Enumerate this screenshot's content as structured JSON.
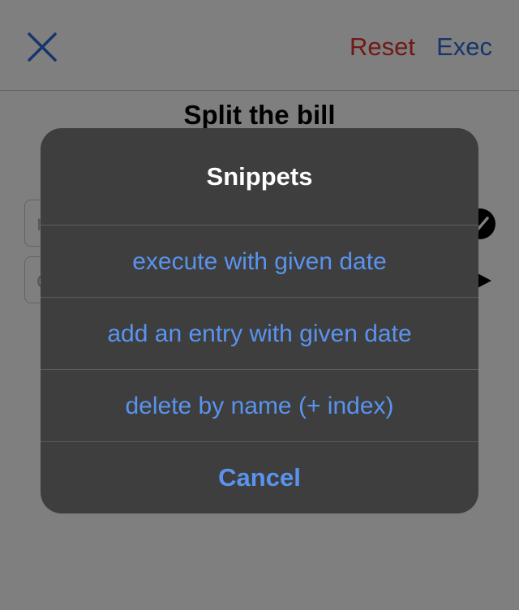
{
  "navbar": {
    "close_icon": "close-x-icon",
    "reset_label": "Reset",
    "exec_label": "Exec",
    "colors": {
      "close": "#2f6bd8",
      "reset": "#e0322b",
      "exec": "#2f6bd8"
    }
  },
  "page": {
    "title": "Split the bill",
    "field_1_placeholder_partial": "n",
    "field_2_placeholder_partial": "c"
  },
  "action_sheet": {
    "title": "Snippets",
    "actions": [
      {
        "label": "execute with given date"
      },
      {
        "label": "add an entry with given date"
      },
      {
        "label": "delete by name (+ index)"
      }
    ],
    "cancel_label": "Cancel",
    "colors": {
      "background": "#3e3e3e",
      "title": "#ffffff",
      "action": "#5a93ee"
    }
  }
}
